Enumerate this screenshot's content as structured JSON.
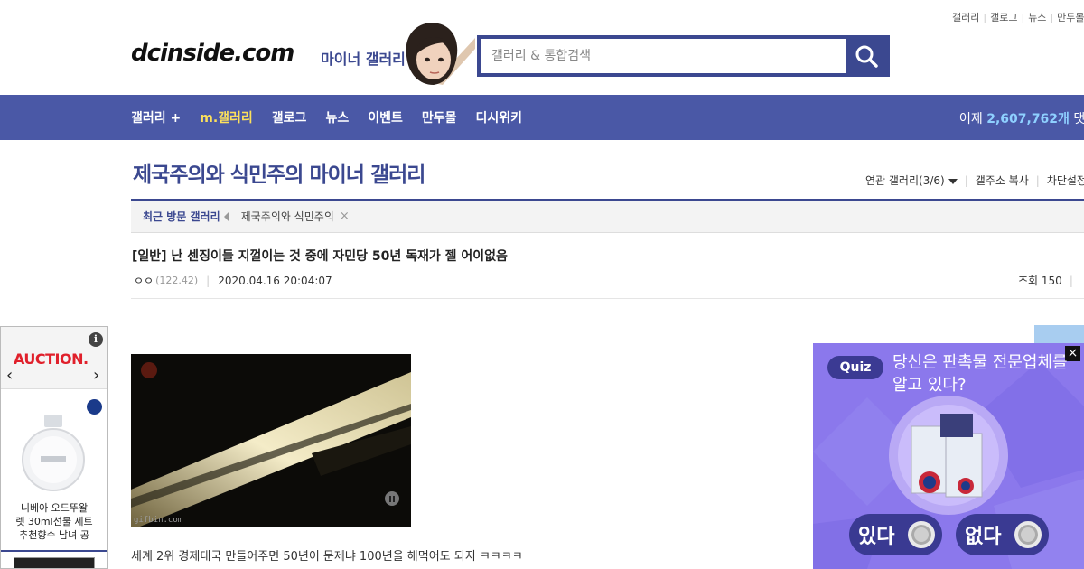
{
  "top_links": [
    "갤러리",
    "갤로그",
    "뉴스",
    "만두몰"
  ],
  "header": {
    "logo": "dcinside.com",
    "logo_sub": "마이너 갤러리",
    "search_placeholder": "갤러리 & 통합검색"
  },
  "nav": {
    "items": [
      {
        "label": "갤러리 +",
        "highlight": false
      },
      {
        "label": "m.갤러리",
        "highlight": true
      },
      {
        "label": "갤로그",
        "highlight": false
      },
      {
        "label": "뉴스",
        "highlight": false
      },
      {
        "label": "이벤트",
        "highlight": false
      },
      {
        "label": "만두몰",
        "highlight": false
      },
      {
        "label": "디시위키",
        "highlight": false
      }
    ],
    "stats_prefix": "어제",
    "stats_value": "2,607,762개",
    "stats_suffix": "댓글"
  },
  "gallery": {
    "title": "제국주의와 식민주의 마이너 갤러리",
    "related": "연관 갤러리(3/6)",
    "copy_address": "갤주소 복사",
    "block_settings": "차단설정"
  },
  "recent": {
    "label": "최근 방문 갤러리",
    "item": "제국주의와 식민주의",
    "close": "×"
  },
  "post": {
    "title": "[일반] 난 센징이들 지껄이는 것 중에 자민당 50년 독재가 젤 어이없음",
    "author": "ㅇㅇ",
    "ip": "(122.42)",
    "date": "2020.04.16 20:04:07",
    "views": "조회 150",
    "gif_credit": "gifbin.com",
    "body": "세계 2위 경제대국 만들어주면 50년이 문제냐 100년을 해먹어도 되지 ㅋㅋㅋㅋ"
  },
  "ad_left": {
    "brand": "AUCTION.",
    "info": "i",
    "prev": "‹",
    "next": "›",
    "caption_lines": [
      "니베아 오드뚜왈",
      "렛 30ml선물 세트",
      "추천향수 남녀 공"
    ]
  },
  "quiz_ad": {
    "tag": "Quiz",
    "question": "당신은 판촉물 전문업체를 알고 있다?",
    "yes": "있다",
    "no": "없다",
    "close": "×"
  },
  "colors": {
    "brand": "#3b4890",
    "nav_bg": "#4a58a6",
    "nav_highlight": "#fce05c",
    "stats_value": "#8ed0ff",
    "quiz_bg": "#8b78ec",
    "auction_red": "#e0202b"
  }
}
